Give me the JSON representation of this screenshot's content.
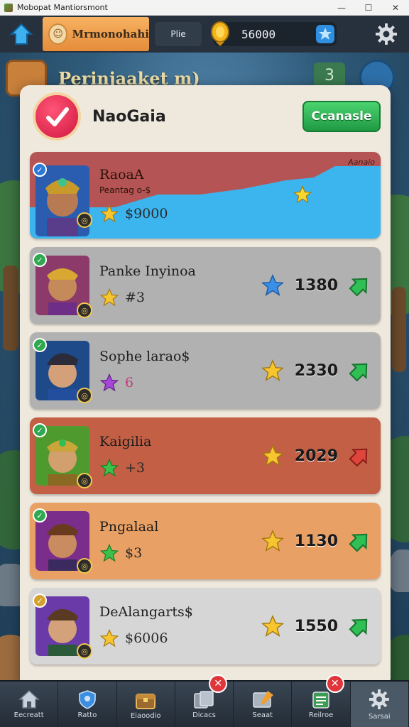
{
  "window": {
    "title": "Mobopat Mantiorsmont",
    "minimize": "—",
    "maximize": "☐",
    "close": "✕"
  },
  "hud": {
    "player_name": "Mrmonohahi",
    "player_tag": "Plie",
    "coins": "56000"
  },
  "background": {
    "title": "Perinjaaket m)",
    "badge": "3"
  },
  "panel": {
    "title": "NaoGaia",
    "cancel_label": "Ccanasle"
  },
  "rows": [
    {
      "name": "RaoaA",
      "sub": "Peantag o-$",
      "stat": "$9000",
      "corner": "Aanaio",
      "score": "",
      "style": "top"
    },
    {
      "name": "Panke Inyinoa",
      "stat": "#3",
      "score": "1380",
      "style": "gray",
      "arrow": "green",
      "star": "blue"
    },
    {
      "name": "Sophe larao$",
      "stat": "6",
      "score": "2330",
      "style": "gray",
      "arrow": "green",
      "star": "gold"
    },
    {
      "name": "Kaigilia",
      "stat": "+3",
      "score": "2029",
      "style": "red",
      "arrow": "red",
      "star": "gold"
    },
    {
      "name": "Pngalaal",
      "stat": "$3",
      "score": "1130",
      "style": "orange",
      "arrow": "green",
      "star": "gold"
    },
    {
      "name": "DeAlangarts$",
      "stat": "$6006",
      "score": "1550",
      "style": "light",
      "arrow": "green",
      "star": "gold"
    }
  ],
  "nav": [
    {
      "label": "Eecreatt",
      "icon": "home-icon"
    },
    {
      "label": "Ratto",
      "icon": "shield-icon"
    },
    {
      "label": "Eiaoodio",
      "icon": "chest-icon"
    },
    {
      "label": "Dicacs",
      "icon": "cards-icon"
    },
    {
      "label": "Seaat",
      "icon": "scroll-icon"
    },
    {
      "label": "Reilroe",
      "icon": "list-icon"
    },
    {
      "label": "Sarsai",
      "icon": "gear-icon"
    }
  ],
  "colors": {
    "accent_green": "#2fa84f",
    "cancel_green": "#1f9a44",
    "hud_orange": "#e58c3a",
    "alert_red": "#e0363b"
  }
}
